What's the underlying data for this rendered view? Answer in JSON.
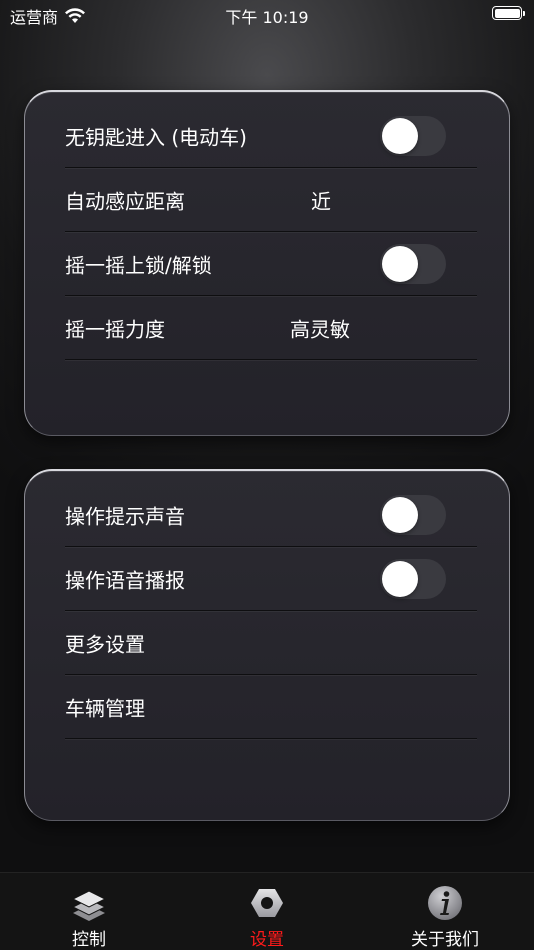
{
  "status_bar": {
    "carrier": "运营商",
    "time": "下午 10:19"
  },
  "panel_1": {
    "rows": [
      {
        "label": "无钥匙进入 (电动车)",
        "toggle": false
      },
      {
        "label": "自动感应距离",
        "value": "近"
      },
      {
        "label": "摇一摇上锁/解锁",
        "toggle": false
      },
      {
        "label": "摇一摇力度",
        "value": "高灵敏"
      }
    ]
  },
  "panel_2": {
    "rows": [
      {
        "label": "操作提示声音",
        "toggle": false
      },
      {
        "label": "操作语音播报",
        "toggle": false
      },
      {
        "label": "更多设置"
      },
      {
        "label": "车辆管理"
      }
    ]
  },
  "tabs": [
    {
      "label": "控制",
      "icon": "layers-icon",
      "active": false
    },
    {
      "label": "设置",
      "icon": "hexagon-gear-icon",
      "active": true
    },
    {
      "label": "关于我们",
      "icon": "info-icon",
      "active": false
    }
  ],
  "colors": {
    "active_tab": "#ff1a1a",
    "panel_bg": "#2b2a31",
    "tab_bar_bg": "#141414"
  }
}
